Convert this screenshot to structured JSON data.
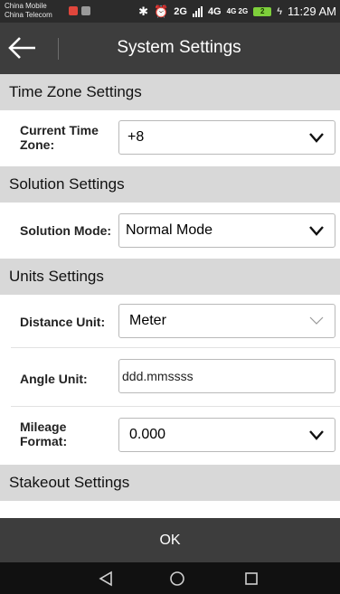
{
  "status_bar": {
    "carrier_1": "China Mobile",
    "carrier_2": "China Telecom",
    "network_2g": "2G",
    "network_4g": "4G",
    "network_4g_sub": "4G 2G",
    "battery_level": "2",
    "time": "11:29 AM"
  },
  "app_bar": {
    "title": "System Settings"
  },
  "sections": {
    "time_zone": {
      "title": "Time Zone Settings",
      "current_time_zone_label": "Current Time Zone:",
      "current_time_zone_value": "+8"
    },
    "solution": {
      "title": "Solution Settings",
      "solution_mode_label": "Solution Mode:",
      "solution_mode_value": "Normal Mode"
    },
    "units": {
      "title": "Units Settings",
      "distance_unit_label": "Distance Unit:",
      "distance_unit_value": "Meter",
      "angle_unit_label": "Angle Unit:",
      "angle_unit_value": "ddd.mmssss",
      "mileage_format_label": "Mileage Format:",
      "mileage_format_value": "0.000"
    },
    "stakeout": {
      "title": "Stakeout Settings"
    }
  },
  "bottom_bar": {
    "ok_label": "OK"
  },
  "colors": {
    "status_bar_bg": "#2b2b2b",
    "app_bar_bg": "#3d3d3d",
    "section_header_bg": "#d8d8d8",
    "nav_bar_bg": "#111111",
    "battery_green": "#7ed03b"
  },
  "icons": {
    "back": "arrow-left-icon",
    "dropdown": "chevron-down-icon",
    "nav_back": "triangle-back-icon",
    "nav_home": "circle-home-icon",
    "nav_recents": "square-recents-icon"
  }
}
